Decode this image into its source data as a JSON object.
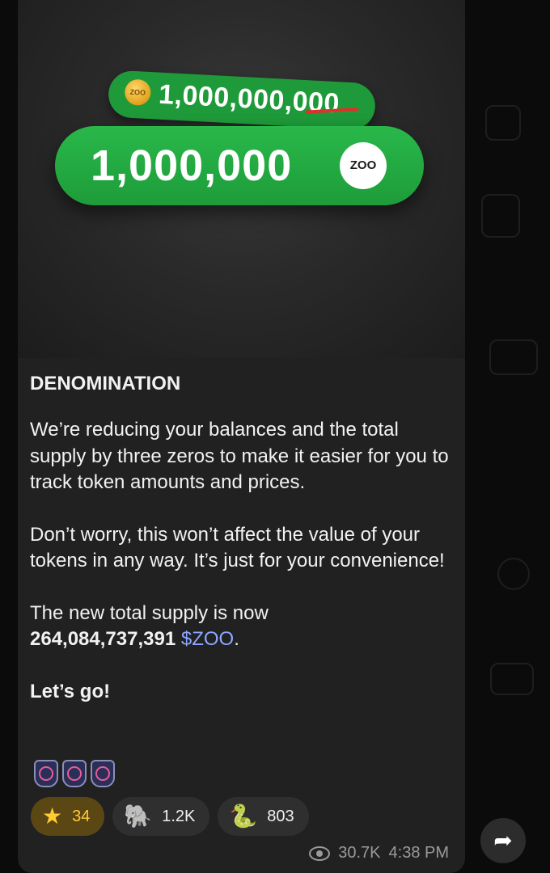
{
  "media": {
    "old_amount": "1,000,000,000",
    "coin_label": "ZOO",
    "new_amount": "1,000,000",
    "new_badge_label": "ZOO"
  },
  "post": {
    "heading": "DENOMINATION",
    "paragraph_1": "We’re reducing your balances and the total supply by three zeros to make it easier for you to track token amounts and prices.",
    "paragraph_2": "Don’t worry, this won’t affect the value of your tokens in any way. It’s just for your convenience!",
    "paragraph_3_prefix": "The new total supply is now",
    "supply_value": "264,084,737,391",
    "ticker": "$ZOO",
    "suffix": ".",
    "closing": "Let’s go!"
  },
  "reactions": [
    {
      "icon": "star-icon",
      "glyph": "★",
      "count": "34",
      "paid": true
    },
    {
      "icon": "elephant-icon",
      "glyph": "🐘",
      "count": "1.2K",
      "paid": false
    },
    {
      "icon": "snake-icon",
      "glyph": "🐍",
      "count": "803",
      "paid": false
    }
  ],
  "meta": {
    "views": "30.7K",
    "time": "4:38 PM"
  },
  "colors": {
    "bubble": "#212121",
    "accent_green": "#29b84a",
    "ticker_link": "#8ea6ff",
    "paid_star": "#ffcc33"
  }
}
